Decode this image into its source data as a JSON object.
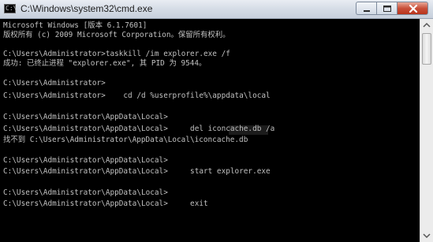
{
  "window": {
    "title": "C:\\Windows\\system32\\cmd.exe",
    "icon": "cmd-icon"
  },
  "title_buttons": {
    "minimize_icon": "minimize-icon",
    "maximize_icon": "maximize-icon",
    "close_icon": "close-icon"
  },
  "console": {
    "lines": [
      "Microsoft Windows [版本 6.1.7601]",
      "版权所有 (c) 2009 Microsoft Corporation。保留所有权利。",
      "",
      "C:\\Users\\Administrator>taskkill /im explorer.exe /f",
      "成功: 已终止进程 \"explorer.exe\", 其 PID 为 9544。",
      "",
      "C:\\Users\\Administrator>",
      "C:\\Users\\Administrator>    cd /d %userprofile%\\appdata\\local",
      "",
      "C:\\Users\\Administrator\\AppData\\Local>",
      "C:\\Users\\Administrator\\AppData\\Local>     del iconcache.db /a",
      "找不到 C:\\Users\\Administrator\\AppData\\Local\\iconcache.db",
      "",
      "C:\\Users\\Administrator\\AppData\\Local>",
      "C:\\Users\\Administrator\\AppData\\Local>     start explorer.exe",
      "",
      "C:\\Users\\Administrator\\AppData\\Local>",
      "C:\\Users\\Administrator\\AppData\\Local>     exit"
    ]
  },
  "colors": {
    "console_background": "#000000",
    "console_text": "#c0c0c0"
  }
}
